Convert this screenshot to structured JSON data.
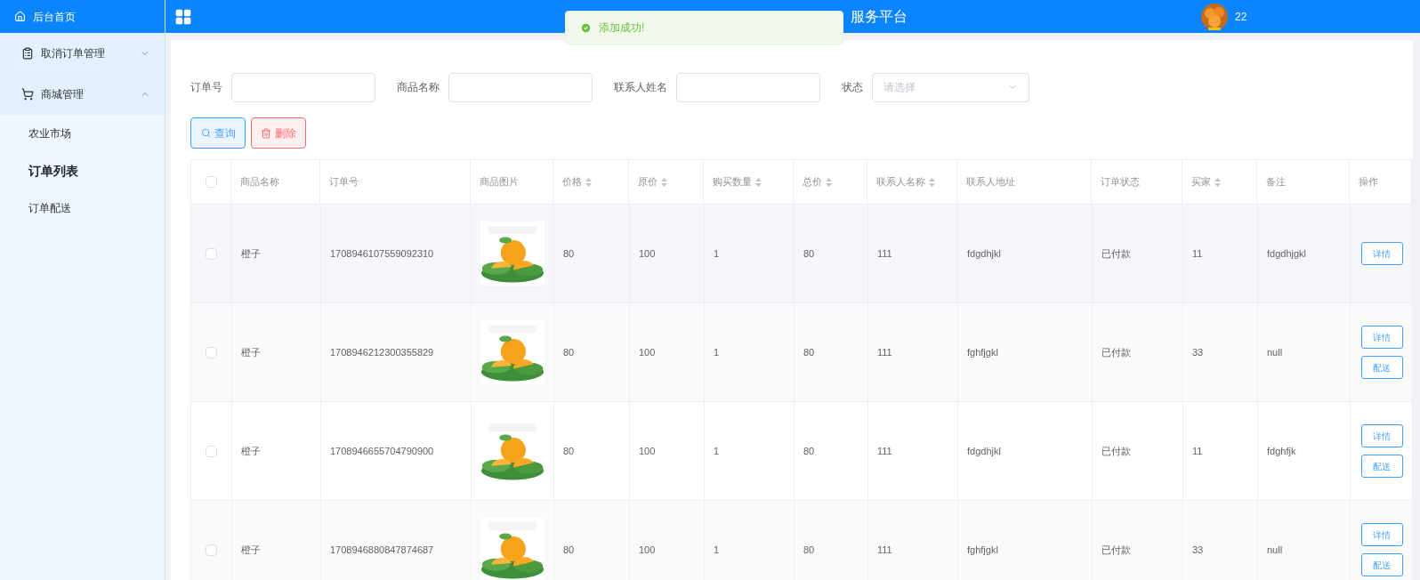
{
  "sidebar": {
    "home": "后台首页",
    "menus": [
      {
        "label": "取消订单管理",
        "expanded": false
      },
      {
        "label": "商城管理",
        "expanded": true,
        "children": [
          {
            "label": "农业市场",
            "selected": false
          },
          {
            "label": "订单列表",
            "selected": true
          },
          {
            "label": "订单配送",
            "selected": false
          }
        ]
      }
    ]
  },
  "header": {
    "title": "服务平台",
    "username": "22"
  },
  "toast": {
    "message": "添加成功!"
  },
  "filters": [
    {
      "label": "订单号",
      "kind": "input"
    },
    {
      "label": "商品名称",
      "kind": "input"
    },
    {
      "label": "联系人姓名",
      "kind": "input"
    },
    {
      "label": "状态",
      "kind": "select",
      "placeholder": "请选择"
    }
  ],
  "buttons": [
    {
      "label": "查询",
      "kind": "search"
    },
    {
      "label": "删除",
      "kind": "delete"
    }
  ],
  "table": {
    "select_all": {
      "checked": false
    },
    "columns": [
      {
        "label": "商品名称",
        "sortable": false
      },
      {
        "label": "订单号",
        "sortable": false
      },
      {
        "label": "商品图片",
        "sortable": false
      },
      {
        "label": "价格",
        "sortable": true
      },
      {
        "label": "原价",
        "sortable": true
      },
      {
        "label": "购买数量",
        "sortable": true
      },
      {
        "label": "总价",
        "sortable": true
      },
      {
        "label": "联系人名称",
        "sortable": true
      },
      {
        "label": "联系人地址",
        "sortable": false
      },
      {
        "label": "订单状态",
        "sortable": false
      },
      {
        "label": "买家",
        "sortable": true
      },
      {
        "label": "备注",
        "sortable": false
      },
      {
        "label": "操作",
        "sortable": false
      }
    ],
    "rows": [
      {
        "checked": false,
        "cells": [
          "橙子",
          "1708946107559092310",
          null,
          "80",
          "100",
          "1",
          "80",
          "111",
          "fdgdhjkl",
          "已付款",
          "11",
          "fdgdhjgkl"
        ],
        "actions": [
          "详情"
        ]
      },
      {
        "checked": false,
        "cells": [
          "橙子",
          "1708946212300355829",
          null,
          "80",
          "100",
          "1",
          "80",
          "111",
          "fghfjgkl",
          "已付款",
          "33",
          "null"
        ],
        "actions": [
          "详情",
          "配送"
        ]
      },
      {
        "checked": false,
        "cells": [
          "橙子",
          "1708946655704790900",
          null,
          "80",
          "100",
          "1",
          "80",
          "111",
          "fdgdhjkl",
          "已付款",
          "11",
          "fdghfjk"
        ],
        "actions": [
          "详情",
          "配送"
        ]
      },
      {
        "checked": false,
        "cells": [
          "橙子",
          "1708946880847874687",
          null,
          "80",
          "100",
          "1",
          "80",
          "111",
          "fghfjgkl",
          "已付款",
          "33",
          "null"
        ],
        "actions": [
          "详情",
          "配送"
        ]
      }
    ]
  }
}
